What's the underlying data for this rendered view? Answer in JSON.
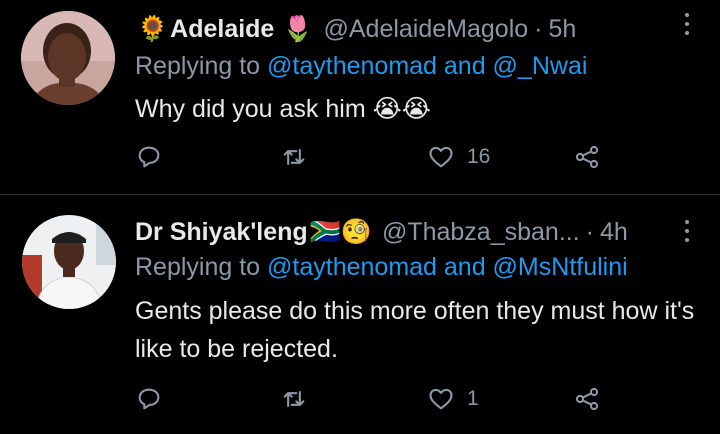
{
  "tweets": [
    {
      "display_name": "Adelaide",
      "name_prefix_emoji": "🌻",
      "name_suffix_emoji": "🌷",
      "handle": "@AdelaideMagolo",
      "time": "5h",
      "replying_prefix": "Replying to",
      "replying_to": "@taythenomad and @_Nwai",
      "text": "Why did you ask him 😭😭",
      "likes": "16",
      "avatar_icon": "avatar-woman"
    },
    {
      "display_name": "Dr Shiyak'leng",
      "name_suffix_emoji": "🇿🇦🧐",
      "handle": "@Thabza_sban...",
      "time": "4h",
      "replying_prefix": "Replying to",
      "replying_to": "@taythenomad and @MsNtfulini",
      "text": "Gents please do this more often they must how it's like to be rejected.",
      "likes": "1",
      "avatar_icon": "avatar-man"
    }
  ],
  "separator": "·",
  "colors": {
    "background": "#000000",
    "text": "#e7e9ea",
    "muted": "#8b98a5",
    "link": "#1d9bf0",
    "divider": "#2f3336"
  }
}
